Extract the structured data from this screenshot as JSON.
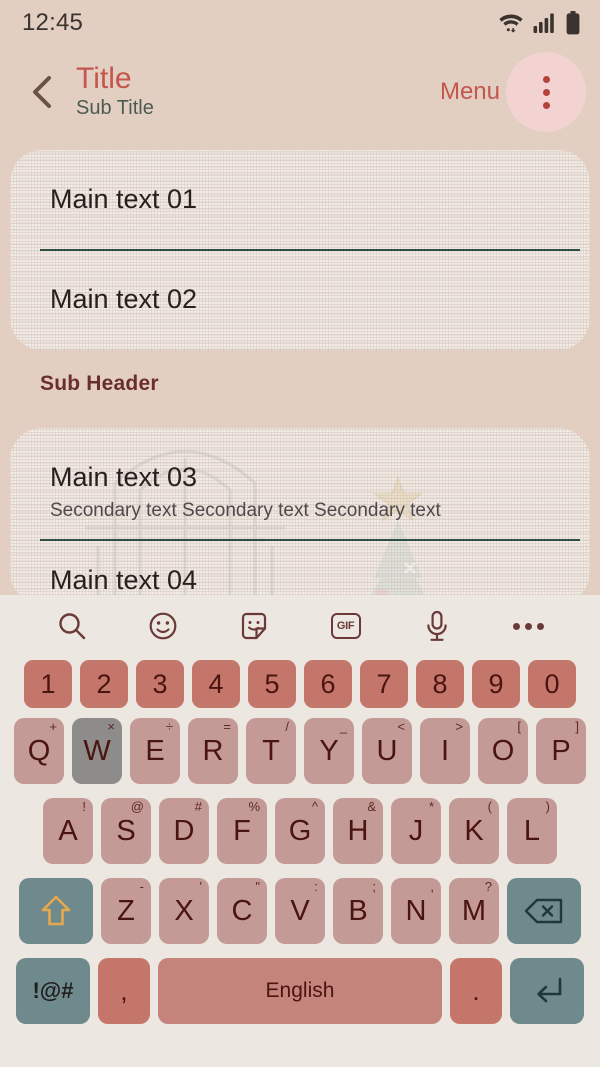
{
  "theme": {
    "page_bg": "#e2cfc1",
    "accent_red": "#c4564d",
    "card_bg": "#f3ece6",
    "divider": "#2f4f45",
    "key_num": "#c4766a",
    "key_letter": "#c49a96",
    "key_fn": "#6f8a8c",
    "key_pressed": "#8e8c8b",
    "keyboard_bg": "#ece7e0"
  },
  "status_bar": {
    "time": "12:45",
    "icons": [
      "wifi-icon",
      "signal-icon",
      "battery-icon"
    ]
  },
  "app_bar": {
    "back_icon": "chevron-left-icon",
    "title": "Title",
    "subtitle": "Sub Title",
    "menu_label": "Menu",
    "overflow_icon": "more-vertical-icon"
  },
  "card1": {
    "rows": [
      {
        "main": "Main text 01"
      },
      {
        "main": "Main text 02"
      }
    ]
  },
  "sub_header": "Sub Header",
  "card2": {
    "rows": [
      {
        "main": "Main text 03",
        "secondary": "Secondary text Secondary text Secondary text"
      },
      {
        "main": "Main text 04"
      }
    ]
  },
  "keyboard": {
    "toolbar": [
      {
        "name": "search-icon",
        "label": ""
      },
      {
        "name": "emoji-icon",
        "label": ""
      },
      {
        "name": "sticker-icon",
        "label": ""
      },
      {
        "name": "gif-icon",
        "label": "GIF"
      },
      {
        "name": "microphone-icon",
        "label": ""
      },
      {
        "name": "more-horizontal-icon",
        "label": ""
      }
    ],
    "row_numbers": [
      {
        "key": "1"
      },
      {
        "key": "2"
      },
      {
        "key": "3"
      },
      {
        "key": "4"
      },
      {
        "key": "5"
      },
      {
        "key": "6"
      },
      {
        "key": "7"
      },
      {
        "key": "8"
      },
      {
        "key": "9"
      },
      {
        "key": "0"
      }
    ],
    "row_q": [
      {
        "key": "Q",
        "sup": "+"
      },
      {
        "key": "W",
        "sup": "×",
        "pressed": true
      },
      {
        "key": "E",
        "sup": "÷"
      },
      {
        "key": "R",
        "sup": "="
      },
      {
        "key": "T",
        "sup": "/"
      },
      {
        "key": "Y",
        "sup": "_"
      },
      {
        "key": "U",
        "sup": "<"
      },
      {
        "key": "I",
        "sup": ">"
      },
      {
        "key": "O",
        "sup": "["
      },
      {
        "key": "P",
        "sup": "]"
      }
    ],
    "row_a": [
      {
        "key": "A",
        "sup": "!"
      },
      {
        "key": "S",
        "sup": "@"
      },
      {
        "key": "D",
        "sup": "#"
      },
      {
        "key": "F",
        "sup": "%"
      },
      {
        "key": "G",
        "sup": "^"
      },
      {
        "key": "H",
        "sup": "&"
      },
      {
        "key": "J",
        "sup": "*"
      },
      {
        "key": "K",
        "sup": "("
      },
      {
        "key": "L",
        "sup": ")"
      }
    ],
    "row_z": [
      {
        "key": "Z",
        "sup": "-"
      },
      {
        "key": "X",
        "sup": "'"
      },
      {
        "key": "C",
        "sup": "\""
      },
      {
        "key": "V",
        "sup": ":"
      },
      {
        "key": "B",
        "sup": ";"
      },
      {
        "key": "N",
        "sup": ","
      },
      {
        "key": "M",
        "sup": "?"
      }
    ],
    "shift_icon": "shift-arrow-icon",
    "delete_icon": "backspace-icon",
    "symbols_key": "!@#",
    "comma_key": ",",
    "space_key": "English",
    "period_key": ".",
    "enter_icon": "enter-return-icon"
  }
}
